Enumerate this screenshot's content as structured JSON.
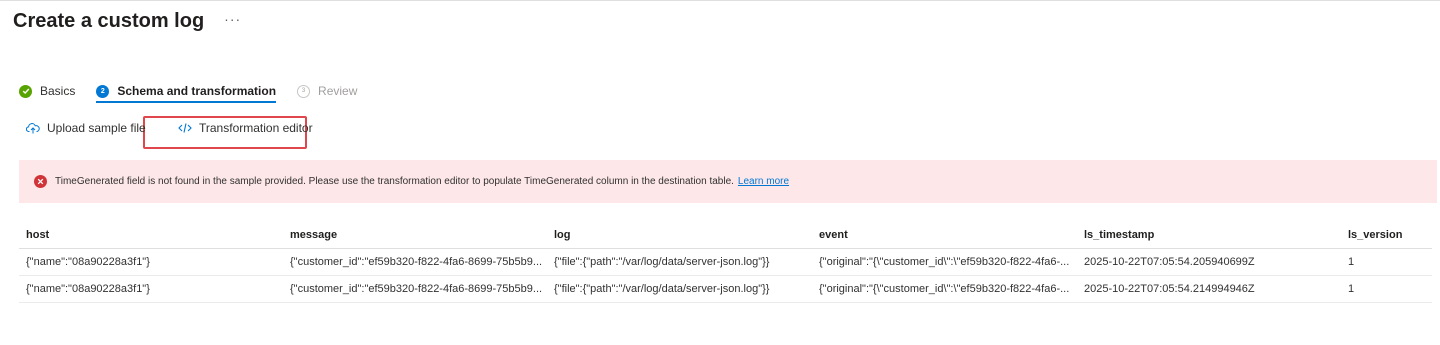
{
  "page": {
    "title": "Create a custom log",
    "more_label": "···"
  },
  "wizard": {
    "tabs": [
      {
        "step": "✓",
        "label": "Basics",
        "state": "done"
      },
      {
        "step": "2",
        "label": "Schema and transformation",
        "state": "active"
      },
      {
        "step": "3",
        "label": "Review",
        "state": "pending"
      }
    ]
  },
  "toolbar": {
    "upload_label": "Upload sample file",
    "editor_label": "Transformation editor"
  },
  "alert": {
    "message": "TimeGenerated field is not found in the sample provided. Please use the transformation editor to populate TimeGenerated column in the destination table.",
    "link": "Learn more"
  },
  "table": {
    "columns": [
      "host",
      "message",
      "log",
      "event",
      "ls_timestamp",
      "ls_version"
    ],
    "rows": [
      [
        "{\"name\":\"08a90228a3f1\"}",
        "{\"customer_id\":\"ef59b320-f822-4fa6-8699-75b5b9...",
        "{\"file\":{\"path\":\"/var/log/data/server-json.log\"}}",
        "{\"original\":\"{\\\"customer_id\\\":\\\"ef59b320-f822-4fa6-...",
        "2025-10-22T07:05:54.205940699Z",
        "1"
      ],
      [
        "{\"name\":\"08a90228a3f1\"}",
        "{\"customer_id\":\"ef59b320-f822-4fa6-8699-75b5b9...",
        "{\"file\":{\"path\":\"/var/log/data/server-json.log\"}}",
        "{\"original\":\"{\\\"customer_id\\\":\\\"ef59b320-f822-4fa6-...",
        "2025-10-22T07:05:54.214994946Z",
        "1"
      ]
    ]
  },
  "colors": {
    "accent": "#0078d4",
    "success": "#57a300",
    "error": "#d13438",
    "error_bg": "#fde7e9",
    "highlight": "#e0474c"
  }
}
